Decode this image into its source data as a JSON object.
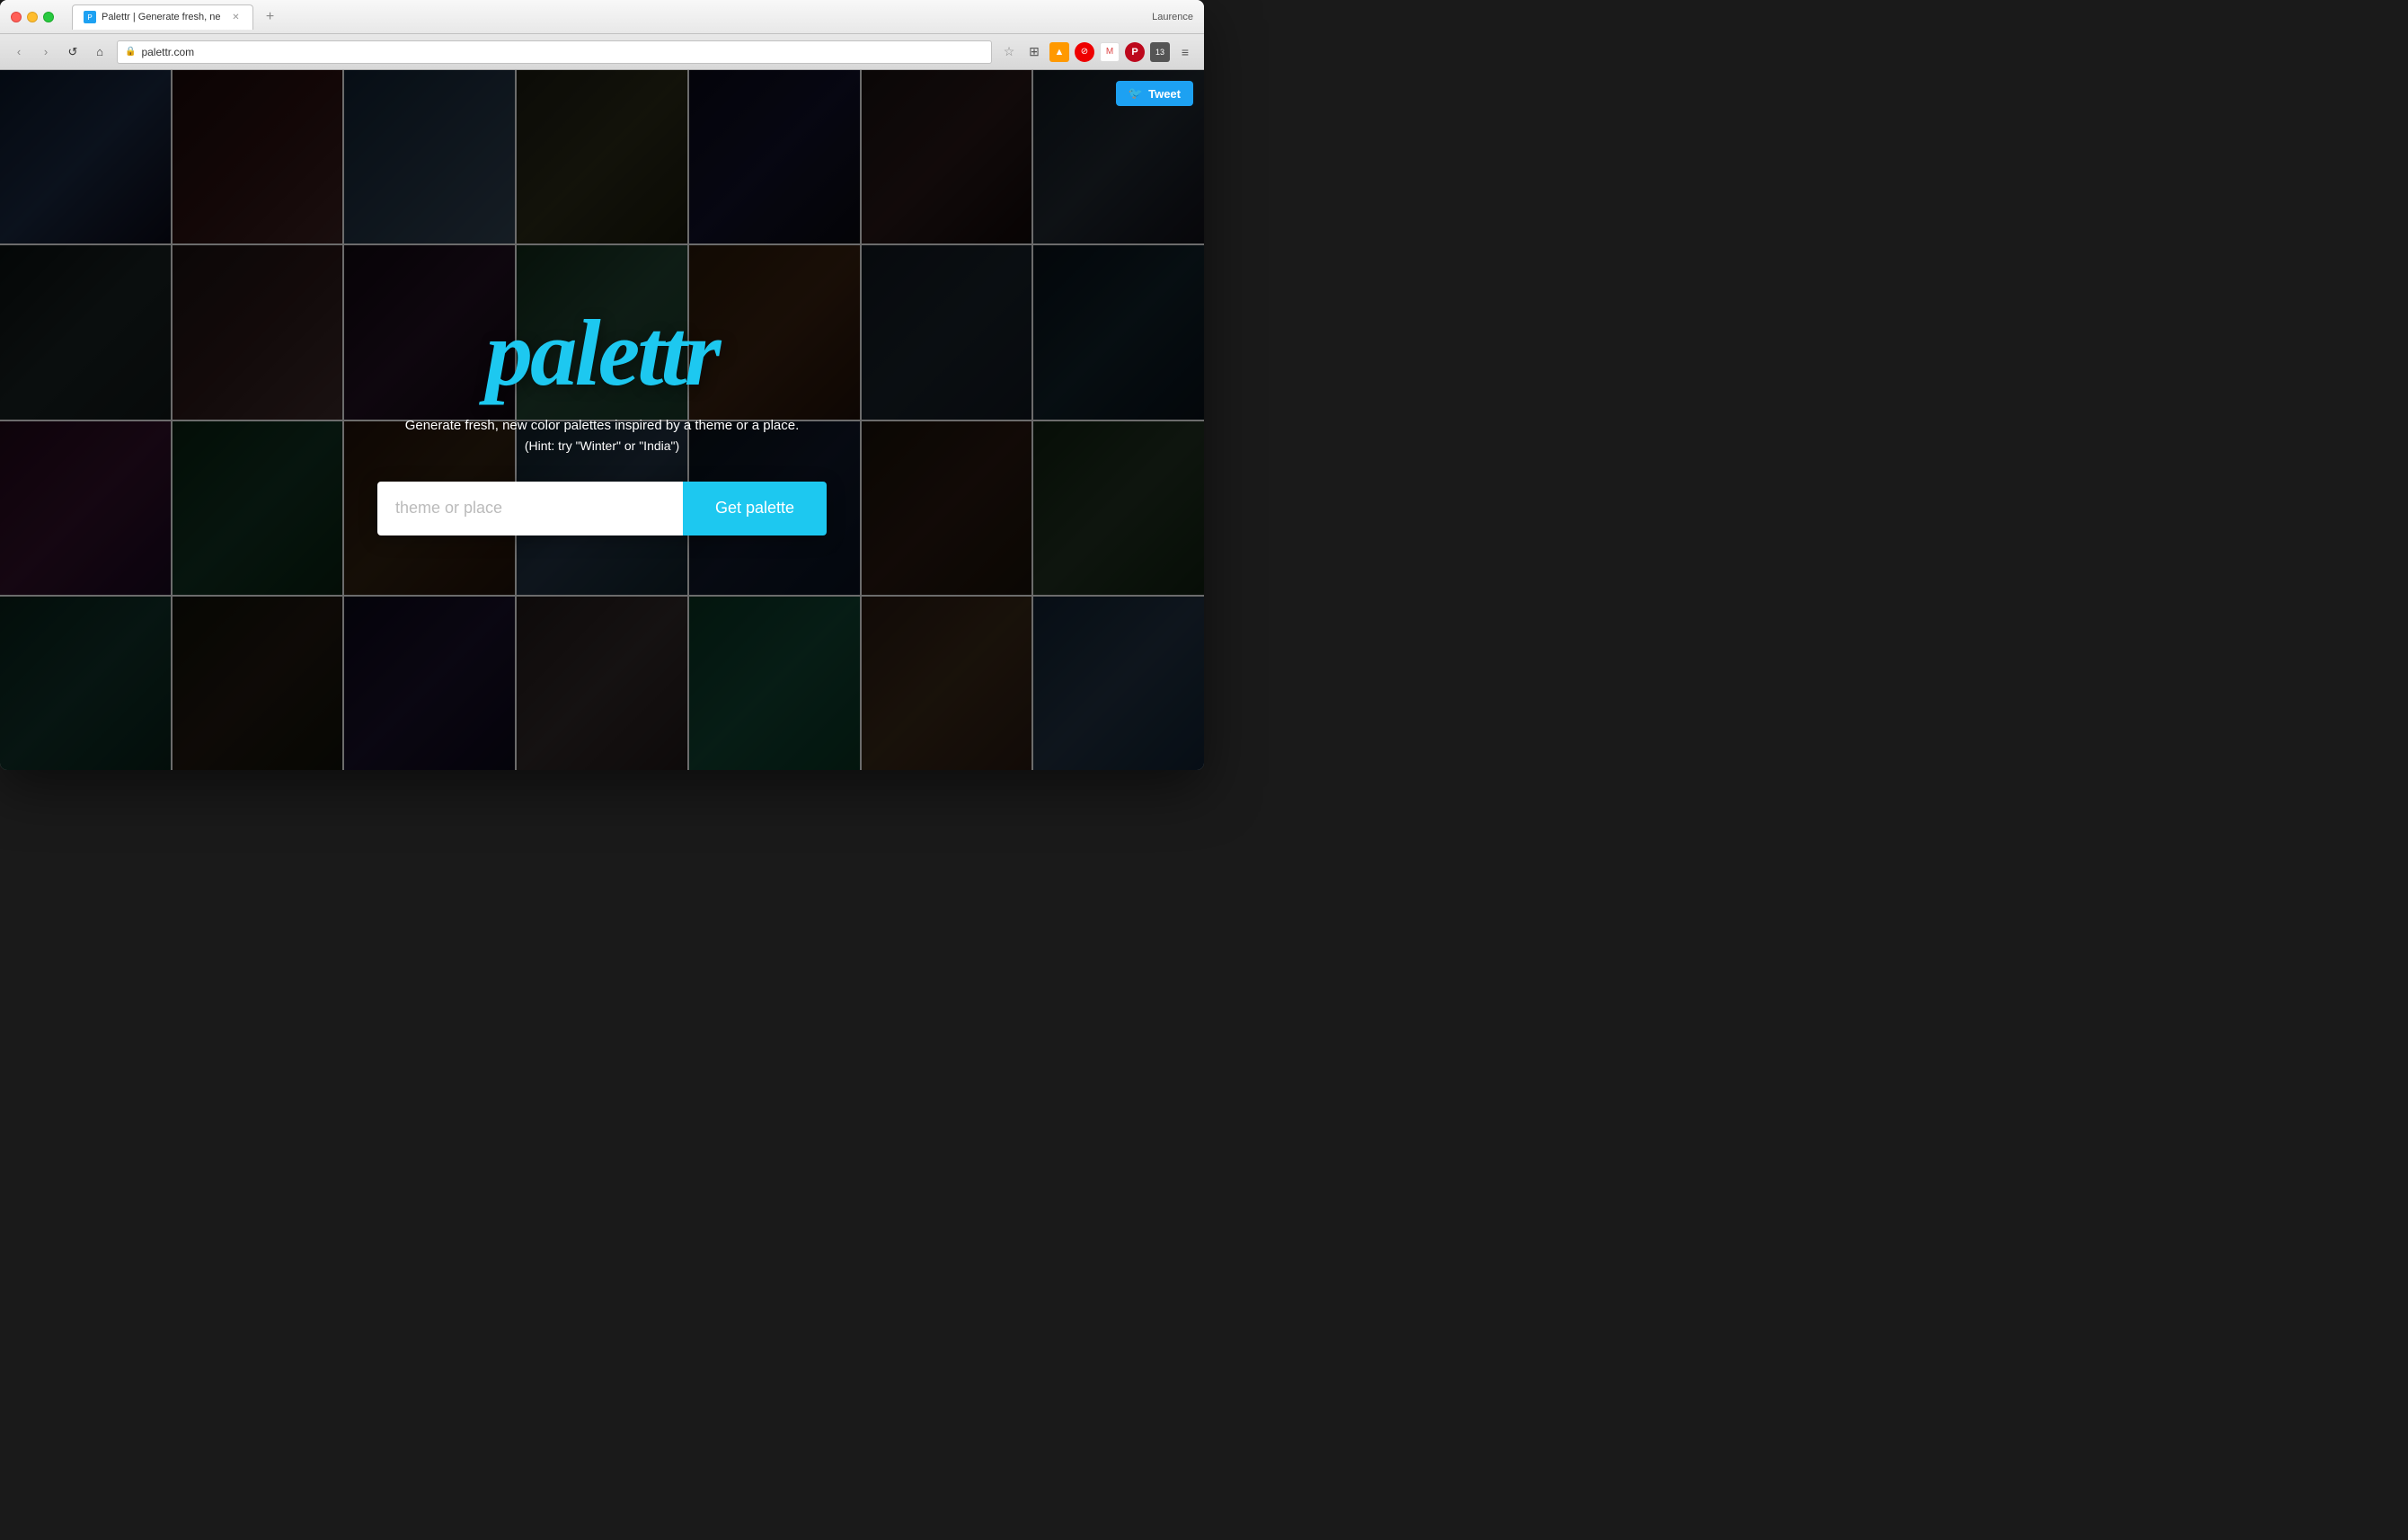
{
  "browser": {
    "title": "Palettr | Generate fresh, ne",
    "url": "palettr.com",
    "user": "Laurence",
    "tab_label": "Palettr | Generate fresh, ne"
  },
  "toolbar": {
    "star_icon": "★",
    "layers_icon": "⊞",
    "menu_icon": "≡",
    "back_icon": "‹",
    "forward_icon": "›",
    "refresh_icon": "↺",
    "home_icon": "⌂",
    "lock_icon": "🔒"
  },
  "tweet_button": {
    "label": "Tweet",
    "icon": "🐦"
  },
  "hero": {
    "logo": "palettr",
    "tagline": "Generate fresh, new color palettes inspired by a theme or a place.",
    "hint": "(Hint: try \"Winter\" or \"India\")",
    "search_placeholder": "theme or place",
    "search_button": "Get palette"
  },
  "colors": {
    "accent": "#1dc8f0",
    "twitter": "#1da1f2"
  }
}
